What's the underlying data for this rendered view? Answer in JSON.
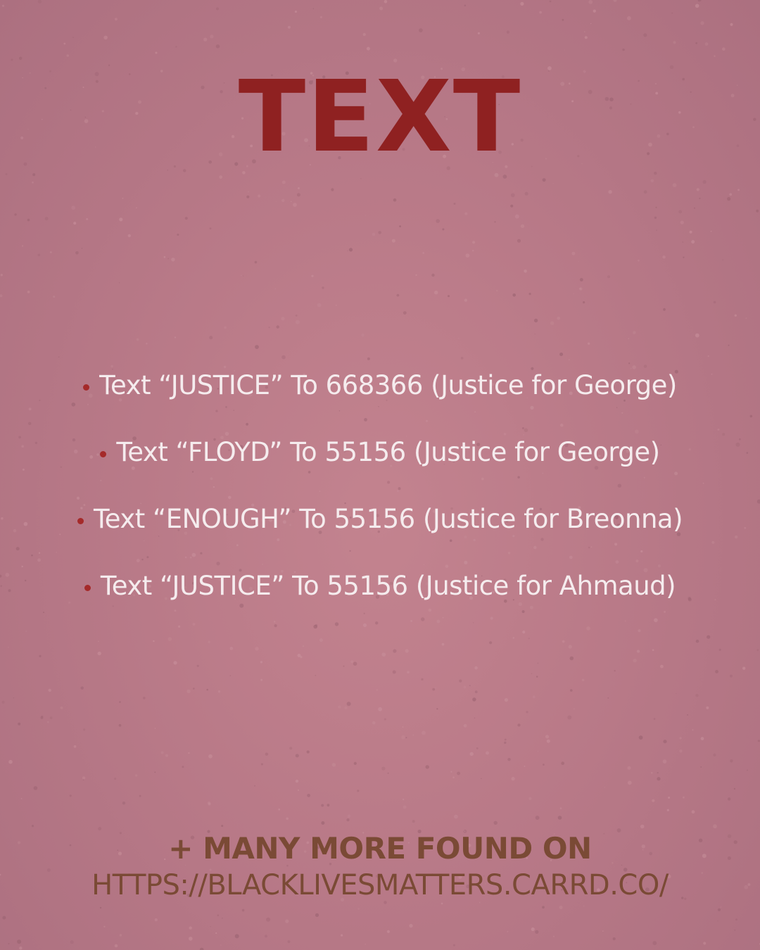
{
  "title": "TEXT",
  "items": [
    "Text “JUSTICE” To 668366 (Justice for George)",
    "Text “FLOYD” To 55156 (Justice for George)",
    "Text “ENOUGH” To 55156 (Justice for Breonna)",
    "Text “JUSTICE” To 55156 (Justice for Ahmaud)"
  ],
  "footer": {
    "line1": "+ MANY MORE FOUND ON",
    "line2": "HTTPS://BLACKLIVESMATTERS.CARRD.CO/"
  },
  "colors": {
    "background": "#bb7b89",
    "title": "#8f2121",
    "bullet": "#a52a2a",
    "item_text": "#f5ecee",
    "footer_text": "#7a4a35"
  }
}
